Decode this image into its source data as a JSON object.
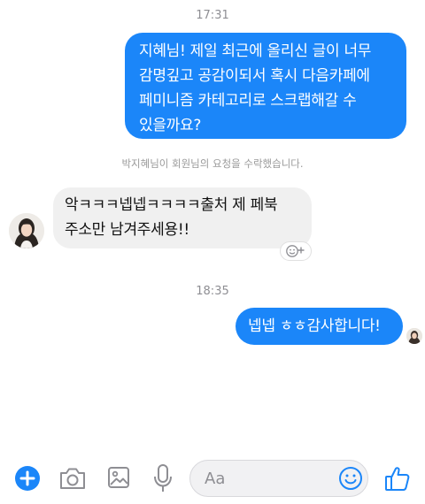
{
  "messages": {
    "time_1": "17:31",
    "outgoing_1_line_1": "지혜님! 제일 최근에 올리신 글이 너무",
    "outgoing_1_line_2": "감명깊고 공감이되서 혹시 다음카페에",
    "outgoing_1_line_3": "페미니즘 카테고리로 스크랩해갈 수",
    "outgoing_1_line_4": "있을까요?",
    "system_notice": "박지혜님이 회원님의 요청을 수락했습니다.",
    "incoming_1_line_1": "악ㅋㅋㅋ넵넵ㅋㅋㅋㅋ출처 제 페북",
    "incoming_1_line_2": "주소만 남겨주세용!!",
    "time_2": "18:35",
    "outgoing_2": "넵넵 ㅎㅎ감사합니다!"
  },
  "composer": {
    "placeholder": "Aa"
  },
  "icons": {
    "plus": "plus-circle-icon",
    "camera": "camera-icon",
    "gallery": "image-icon",
    "mic": "microphone-icon",
    "emoji": "smiley-icon",
    "like": "thumbs-up-icon",
    "reaction": "add-reaction-icon"
  },
  "colors": {
    "accent": "#1b86f9",
    "incoming_bubble": "#f0f0f0",
    "meta_text": "#8e8e93"
  }
}
